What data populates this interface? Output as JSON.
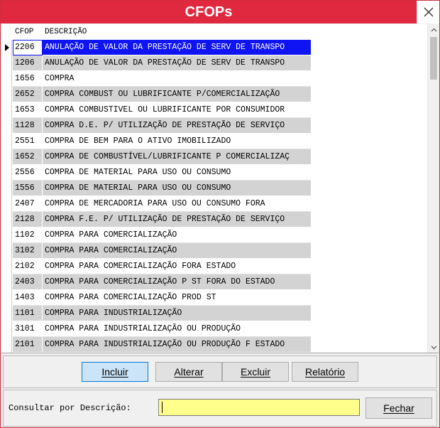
{
  "window": {
    "title": "CFOPs"
  },
  "grid": {
    "columns": [
      "CFOP",
      "DESCRIÇÃO"
    ],
    "rows": [
      {
        "cfop": "2206",
        "desc": "ANULAÇÃO DE VALOR DA PRESTAÇÃO DE SERV DE TRANSPO"
      },
      {
        "cfop": "1206",
        "desc": "ANULAÇÃO DE VALOR DA PRESTAÇÃO DE SERV DE TRANSPO"
      },
      {
        "cfop": "1656",
        "desc": "COMPRA"
      },
      {
        "cfop": "2652",
        "desc": "COMPRA COMBUST OU LUBRIFICANTE P/COMERCIALIZAÇÃO"
      },
      {
        "cfop": "1653",
        "desc": "COMPRA COMBUSTIVEL OU LUBRIFICANTE POR CONSUMIDOR"
      },
      {
        "cfop": "1128",
        "desc": "COMPRA D.E. P/ UTILIZAÇÃO DE PRESTAÇÃO DE SERVIÇO"
      },
      {
        "cfop": "2551",
        "desc": "COMPRA DE BEM PARA O ATIVO IMOBILIZADO"
      },
      {
        "cfop": "1652",
        "desc": "COMPRA DE COMBUSTÍVEL/LUBRIFICANTE P COMERCIALIZAÇ"
      },
      {
        "cfop": "2556",
        "desc": "COMPRA DE MATERIAL PARA USO OU CONSUMO"
      },
      {
        "cfop": "1556",
        "desc": "COMPRA DE MATERIAL PARA USO OU CONSUMO"
      },
      {
        "cfop": "2407",
        "desc": "COMPRA DE MERCADORIA PARA USO OU CONSUMO FORA"
      },
      {
        "cfop": "2128",
        "desc": "COMPRA F.E. P/ UTILIZAÇÃO DE PRESTAÇÃO DE SERVIÇO"
      },
      {
        "cfop": "1102",
        "desc": "COMPRA PARA COMERCIALIZAÇÃO"
      },
      {
        "cfop": "3102",
        "desc": "COMPRA PARA COMERCIALIZAÇÃO"
      },
      {
        "cfop": "2102",
        "desc": "COMPRA PARA COMERCIALIZAÇÃO FORA ESTADO"
      },
      {
        "cfop": "2403",
        "desc": "COMPRA PARA COMERCIALIZAÇÃO P ST FORA DO ESTADO"
      },
      {
        "cfop": "1403",
        "desc": "COMPRA PARA COMERCIALIZAÇÃO PROD ST"
      },
      {
        "cfop": "1101",
        "desc": "COMPRA PARA INDUSTRIALIZAÇÃO"
      },
      {
        "cfop": "3101",
        "desc": "COMPRA PARA INDUSTRIALIZAÇÃO OU PRODUÇÃO"
      },
      {
        "cfop": "2101",
        "desc": "COMPRA PARA INDUSTRIALIZAÇÃO OU PRODUÇÃO F ESTADO"
      }
    ]
  },
  "buttons": {
    "incluir": "Incluir",
    "alterar": "Alterar",
    "excluir": "Excluir",
    "relatorio": "Relatório"
  },
  "search": {
    "label": "Consultar por Descrição:",
    "value": "",
    "close_label": "Fechar"
  },
  "colors": {
    "titlebar": "#e0283f",
    "selection": "#0f14f5",
    "row_alt": "#d3d3d3",
    "search_bg": "#ffff8c"
  },
  "icons": {
    "close": "close-icon",
    "row_indicator": "row-pointer-icon",
    "scroll_up": "chevron-up-icon",
    "scroll_down": "chevron-down-icon"
  }
}
